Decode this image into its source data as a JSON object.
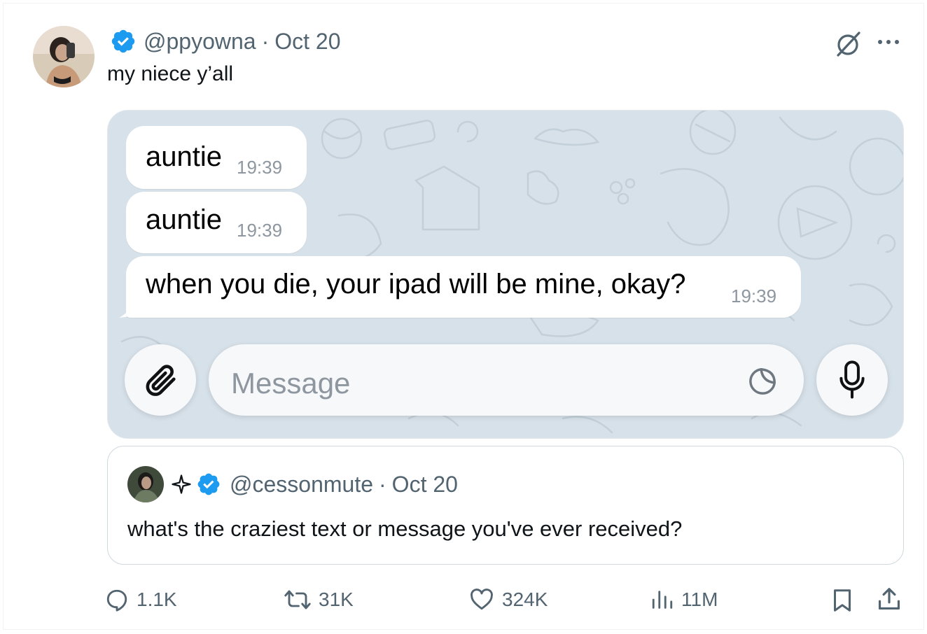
{
  "tweet": {
    "handle": "@ppyowna",
    "separator": "·",
    "date": "Oct 20",
    "text": "my niece y’all"
  },
  "chat": {
    "messages": [
      {
        "text": "auntie",
        "time": "19:39"
      },
      {
        "text": "auntie",
        "time": "19:39"
      },
      {
        "text": "when you die, your ipad will be mine, okay?",
        "time": "19:39"
      }
    ],
    "input_placeholder": "Message"
  },
  "quote": {
    "handle": "@cessonmute",
    "separator": "·",
    "date": "Oct 20",
    "text": "what's the craziest text or message you've ever received?"
  },
  "actions": {
    "replies": "1.1K",
    "reposts": "31K",
    "likes": "324K",
    "views": "11M"
  },
  "colors": {
    "verified": "#1d9bf0",
    "secondary_text": "#536471",
    "chat_background": "#d7e1e9"
  }
}
